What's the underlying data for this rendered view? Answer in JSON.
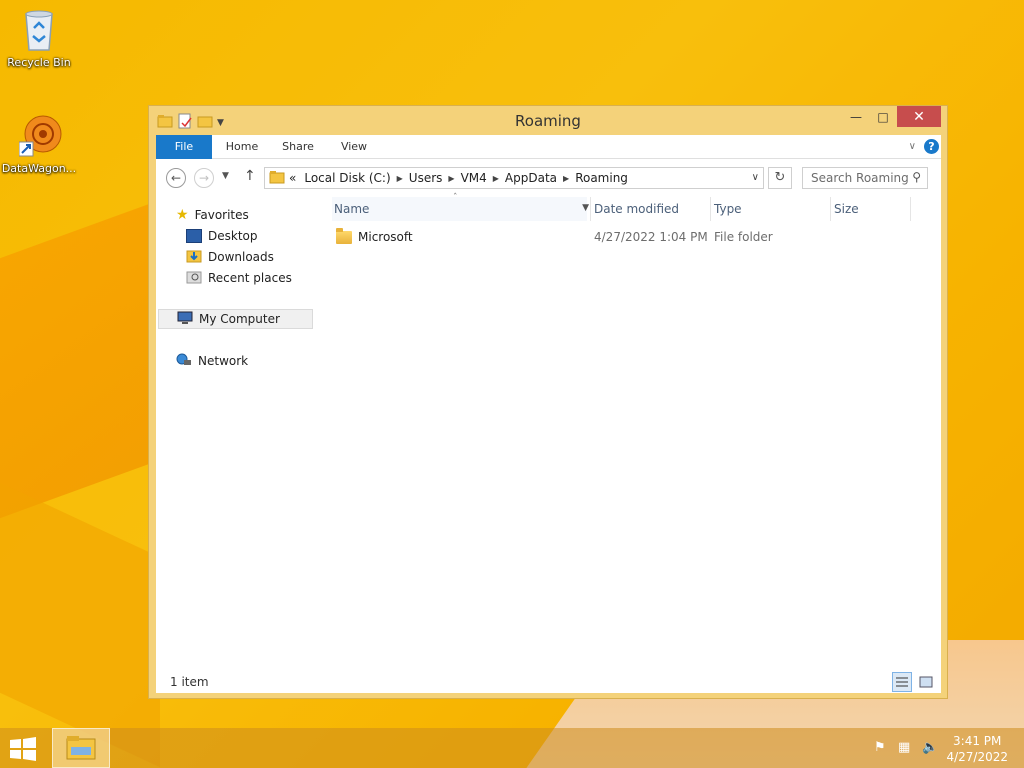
{
  "desktop": {
    "icons": [
      {
        "label": "Recycle Bin"
      },
      {
        "label": "DataWagon..."
      }
    ]
  },
  "window": {
    "title": "Roaming",
    "controls": {
      "minimize": "—",
      "maximize": "□",
      "close": "✕"
    },
    "ribbon_tabs": [
      "File",
      "Home",
      "Share",
      "View"
    ],
    "address": {
      "overflow": "«",
      "crumbs": [
        "Local Disk (C:)",
        "Users",
        "VM4",
        "AppData",
        "Roaming"
      ]
    },
    "search_placeholder": "Search Roaming",
    "nav": {
      "favorites": "Favorites",
      "desktop": "Desktop",
      "downloads": "Downloads",
      "recent_places": "Recent places",
      "my_computer": "My Computer",
      "network": "Network"
    },
    "columns": {
      "name": "Name",
      "date_modified": "Date modified",
      "type": "Type",
      "size": "Size"
    },
    "files": [
      {
        "name": "Microsoft",
        "date_modified": "4/27/2022 1:04 PM",
        "type": "File folder",
        "size": ""
      }
    ],
    "status": "1 item"
  },
  "taskbar": {
    "time": "3:41 PM",
    "date": "4/27/2022"
  },
  "colors": {
    "accent": "#1979ca",
    "close_button": "#c74d4d",
    "window_frame": "#f4d27a",
    "desktop": "#f6b900"
  }
}
